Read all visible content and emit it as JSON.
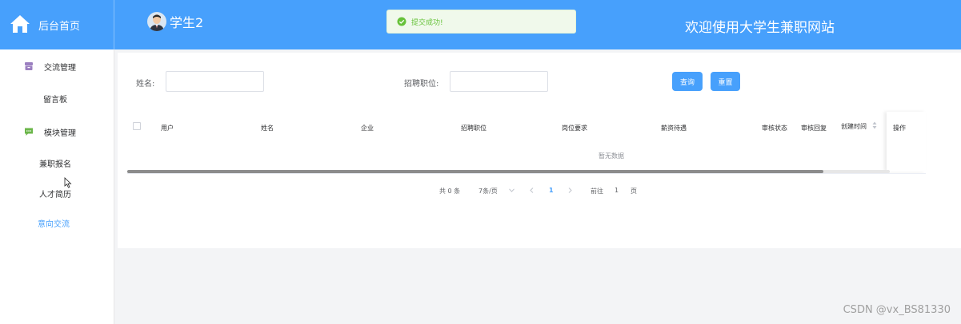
{
  "header": {
    "logo_text": "后台首页",
    "user_name": "学生2",
    "site_title": "欢迎使用大学生兼职网站",
    "bg_color": "#47a0fc"
  },
  "toast": {
    "text": "提交成功!"
  },
  "sidebar": {
    "groups": [
      {
        "label": "交流管理",
        "icon": "archive-icon",
        "items": [
          "留言板"
        ]
      },
      {
        "label": "模块管理",
        "icon": "chat-icon",
        "items": [
          "兼职报名",
          "人才简历",
          "意向交流"
        ]
      }
    ],
    "active_item": "意向交流"
  },
  "search": {
    "name_label": "姓名:",
    "position_label": "招聘职位:",
    "query_button": "查询",
    "reset_button": "重置"
  },
  "table": {
    "columns": [
      "用户",
      "姓名",
      "企业",
      "招聘职位",
      "岗位要求",
      "薪资待遇",
      "审核状态",
      "审核回复",
      "创建时间",
      "操作"
    ],
    "empty_text": "暂无数据"
  },
  "pagination": {
    "total": "共 0 条",
    "page_size": "7条/页",
    "current_page": "1",
    "goto_label": "前往",
    "goto_value": "1",
    "page_unit": "页"
  },
  "watermark": "CSDN @vx_BS81330"
}
